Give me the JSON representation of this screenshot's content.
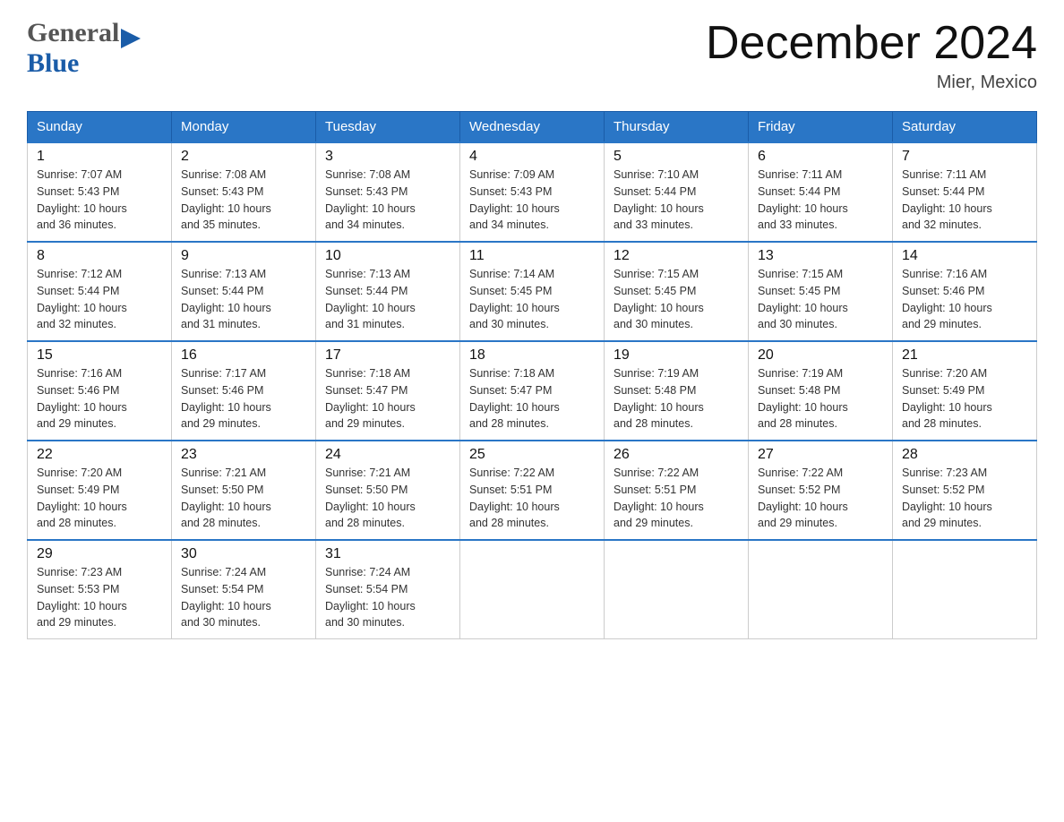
{
  "header": {
    "logo": {
      "general_text": "General",
      "blue_text": "Blue",
      "arrow_symbol": "▶"
    },
    "title": "December 2024",
    "location": "Mier, Mexico"
  },
  "calendar": {
    "days_of_week": [
      "Sunday",
      "Monday",
      "Tuesday",
      "Wednesday",
      "Thursday",
      "Friday",
      "Saturday"
    ],
    "weeks": [
      [
        {
          "day": "1",
          "sunrise": "7:07 AM",
          "sunset": "5:43 PM",
          "daylight": "10 hours and 36 minutes."
        },
        {
          "day": "2",
          "sunrise": "7:08 AM",
          "sunset": "5:43 PM",
          "daylight": "10 hours and 35 minutes."
        },
        {
          "day": "3",
          "sunrise": "7:08 AM",
          "sunset": "5:43 PM",
          "daylight": "10 hours and 34 minutes."
        },
        {
          "day": "4",
          "sunrise": "7:09 AM",
          "sunset": "5:43 PM",
          "daylight": "10 hours and 34 minutes."
        },
        {
          "day": "5",
          "sunrise": "7:10 AM",
          "sunset": "5:44 PM",
          "daylight": "10 hours and 33 minutes."
        },
        {
          "day": "6",
          "sunrise": "7:11 AM",
          "sunset": "5:44 PM",
          "daylight": "10 hours and 33 minutes."
        },
        {
          "day": "7",
          "sunrise": "7:11 AM",
          "sunset": "5:44 PM",
          "daylight": "10 hours and 32 minutes."
        }
      ],
      [
        {
          "day": "8",
          "sunrise": "7:12 AM",
          "sunset": "5:44 PM",
          "daylight": "10 hours and 32 minutes."
        },
        {
          "day": "9",
          "sunrise": "7:13 AM",
          "sunset": "5:44 PM",
          "daylight": "10 hours and 31 minutes."
        },
        {
          "day": "10",
          "sunrise": "7:13 AM",
          "sunset": "5:44 PM",
          "daylight": "10 hours and 31 minutes."
        },
        {
          "day": "11",
          "sunrise": "7:14 AM",
          "sunset": "5:45 PM",
          "daylight": "10 hours and 30 minutes."
        },
        {
          "day": "12",
          "sunrise": "7:15 AM",
          "sunset": "5:45 PM",
          "daylight": "10 hours and 30 minutes."
        },
        {
          "day": "13",
          "sunrise": "7:15 AM",
          "sunset": "5:45 PM",
          "daylight": "10 hours and 30 minutes."
        },
        {
          "day": "14",
          "sunrise": "7:16 AM",
          "sunset": "5:46 PM",
          "daylight": "10 hours and 29 minutes."
        }
      ],
      [
        {
          "day": "15",
          "sunrise": "7:16 AM",
          "sunset": "5:46 PM",
          "daylight": "10 hours and 29 minutes."
        },
        {
          "day": "16",
          "sunrise": "7:17 AM",
          "sunset": "5:46 PM",
          "daylight": "10 hours and 29 minutes."
        },
        {
          "day": "17",
          "sunrise": "7:18 AM",
          "sunset": "5:47 PM",
          "daylight": "10 hours and 29 minutes."
        },
        {
          "day": "18",
          "sunrise": "7:18 AM",
          "sunset": "5:47 PM",
          "daylight": "10 hours and 28 minutes."
        },
        {
          "day": "19",
          "sunrise": "7:19 AM",
          "sunset": "5:48 PM",
          "daylight": "10 hours and 28 minutes."
        },
        {
          "day": "20",
          "sunrise": "7:19 AM",
          "sunset": "5:48 PM",
          "daylight": "10 hours and 28 minutes."
        },
        {
          "day": "21",
          "sunrise": "7:20 AM",
          "sunset": "5:49 PM",
          "daylight": "10 hours and 28 minutes."
        }
      ],
      [
        {
          "day": "22",
          "sunrise": "7:20 AM",
          "sunset": "5:49 PM",
          "daylight": "10 hours and 28 minutes."
        },
        {
          "day": "23",
          "sunrise": "7:21 AM",
          "sunset": "5:50 PM",
          "daylight": "10 hours and 28 minutes."
        },
        {
          "day": "24",
          "sunrise": "7:21 AM",
          "sunset": "5:50 PM",
          "daylight": "10 hours and 28 minutes."
        },
        {
          "day": "25",
          "sunrise": "7:22 AM",
          "sunset": "5:51 PM",
          "daylight": "10 hours and 28 minutes."
        },
        {
          "day": "26",
          "sunrise": "7:22 AM",
          "sunset": "5:51 PM",
          "daylight": "10 hours and 29 minutes."
        },
        {
          "day": "27",
          "sunrise": "7:22 AM",
          "sunset": "5:52 PM",
          "daylight": "10 hours and 29 minutes."
        },
        {
          "day": "28",
          "sunrise": "7:23 AM",
          "sunset": "5:52 PM",
          "daylight": "10 hours and 29 minutes."
        }
      ],
      [
        {
          "day": "29",
          "sunrise": "7:23 AM",
          "sunset": "5:53 PM",
          "daylight": "10 hours and 29 minutes."
        },
        {
          "day": "30",
          "sunrise": "7:24 AM",
          "sunset": "5:54 PM",
          "daylight": "10 hours and 30 minutes."
        },
        {
          "day": "31",
          "sunrise": "7:24 AM",
          "sunset": "5:54 PM",
          "daylight": "10 hours and 30 minutes."
        },
        null,
        null,
        null,
        null
      ]
    ],
    "sunrise_label": "Sunrise:",
    "sunset_label": "Sunset:",
    "daylight_label": "Daylight:"
  },
  "accent_color": "#2a76c6"
}
